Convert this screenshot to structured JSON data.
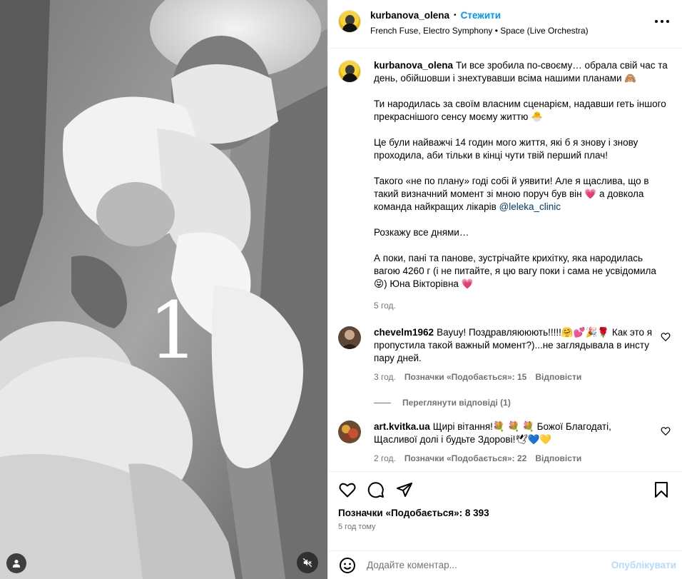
{
  "post": {
    "username": "kurbanova_olena",
    "follow_label": "Стежити",
    "separator": "•",
    "music": "French Fuse, Electro Symphony • Space (Live Orchestra)",
    "caption_paragraphs": [
      "Ти все зробила по-своєму… обрала свій час та день, обійшовши і знехтувавши всіма нашими планами 🙈",
      "Ти народилась за своїм власним сценарієм, надавши геть іншого прекраснішого сенсу моєму життю 🐣",
      "Це були найважчі 14 годин мого життя, які б я знову і знову проходила, аби тільки в кінці чути твій перший плач!",
      "Такого «не по плану» годі собі й уявити! Але я щаслива, що в такий визначний момент зі мною поруч був він 💗 а довкола команда найкращих лікарів",
      "Розкажу все днями…",
      "А поки, пані та панове, зустрічайте крихітку, яка народилась вагою 4260 г (і не питайте, я цю вагу поки і сама не усвідомила 😝) Юна Вікторівна 💗"
    ],
    "mention": "@leleka_clinic",
    "caption_time": "5 год.",
    "image_overlay_number": "1"
  },
  "comments": [
    {
      "username": "chevelm1962",
      "text": "Вауuу! Поздравляююють!!!!!🤗💕🎉🌹 Как это я пропустила такой важный момент?)...не заглядывала в инсту пару дней.",
      "time": "3 год.",
      "likes": "Позначки «Подобається»: 15",
      "reply_label": "Відповісти",
      "view_replies": "Переглянути відповіді (1)"
    },
    {
      "username": "art.kvitka.ua",
      "text": "Щирі вітання!💐 💐 💐 Божої Благодаті, Щасливої долі і будьте Здорові!🕊💙💛",
      "time": "2 год.",
      "likes": "Позначки «Подобається»: 22",
      "reply_label": "Відповісти"
    }
  ],
  "actions": {
    "likes_count": "Позначки «Подобається»: 8 393",
    "date": "5 год тому",
    "comment_placeholder": "Додайте коментар...",
    "post_label": "Опублікувати"
  },
  "icons": {
    "more": "more-horizontal-icon",
    "like": "heart-icon",
    "comment": "comment-icon",
    "share": "share-icon",
    "save": "bookmark-icon",
    "emoji": "emoji-icon",
    "mute": "audio-muted-icon",
    "tag": "user-tag-icon"
  },
  "colors": {
    "accent": "#0095f6",
    "muted_text": "#737373",
    "mention": "#00376b",
    "post_disabled": "#b3dbff"
  }
}
